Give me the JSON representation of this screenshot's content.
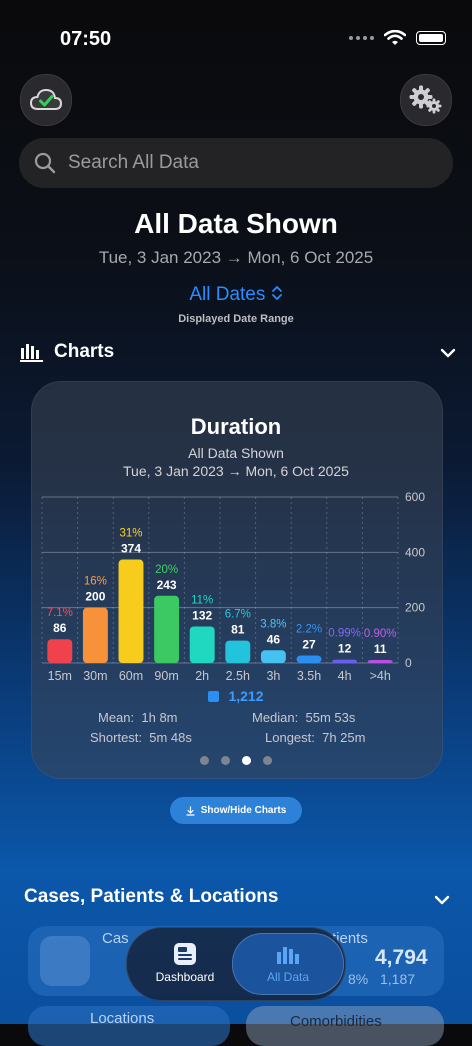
{
  "status": {
    "time": "07:50"
  },
  "search": {
    "placeholder": "Search All Data"
  },
  "header": {
    "title": "All Data Shown",
    "range": "Tue, 3 Jan 2023 → Mon, 6 Oct 2025",
    "dates_link": "All Dates",
    "caption": "Displayed Date Range"
  },
  "charts_section": {
    "label": "Charts"
  },
  "chart_card": {
    "title": "Duration",
    "subtitle": "All Data Shown",
    "range": "Tue, 3 Jan 2023 → Mon, 6 Oct 2025",
    "total": "1,212",
    "stats": {
      "mean_label": "Mean:",
      "mean_value": "1h 8m",
      "median_label": "Median:",
      "median_value": "55m 53s",
      "shortest_label": "Shortest:",
      "shortest_value": "5m 48s",
      "longest_label": "Longest:",
      "longest_value": "7h 25m"
    },
    "pages": 4,
    "active_page": 2
  },
  "chart_data": {
    "type": "bar",
    "categories": [
      "15m",
      "30m",
      "60m",
      "90m",
      "2h",
      "2.5h",
      "3h",
      "3.5h",
      "4h",
      ">4h"
    ],
    "values": [
      86,
      200,
      374,
      243,
      132,
      81,
      46,
      27,
      12,
      11
    ],
    "percent_labels": [
      "7.1%",
      "16%",
      "31%",
      "20%",
      "11%",
      "6.7%",
      "3.8%",
      "2.2%",
      "0.99%",
      "0.90%"
    ],
    "colors": [
      "#f0424d",
      "#f7923a",
      "#f7cc1c",
      "#3cc862",
      "#20d8c0",
      "#22c4dd",
      "#45c2f2",
      "#2a8ff0",
      "#6a5cf0",
      "#c04ce6"
    ],
    "percent_colors": [
      "#ff4d55",
      "#ff9c3d",
      "#ffd21e",
      "#3ed064",
      "#24d6c0",
      "#28c8e0",
      "#4ac8f5",
      "#3596f5",
      "#8068ff",
      "#c659ee"
    ],
    "yticks": [
      0,
      200,
      400,
      600
    ],
    "ylim": [
      0,
      600
    ],
    "grid": true
  },
  "show_hide_button": {
    "label": "Show/Hide Charts"
  },
  "cases_section": {
    "label": "Cases, Patients & Locations"
  },
  "tiles": {
    "cases_label": "Cas",
    "patients_label": "tients",
    "patients_value": "4,794",
    "patients_sub": "1,187",
    "patients_pct": "8%",
    "locations_label": "Locations",
    "comorbidities_label": "Comorbidities"
  },
  "tabbar": {
    "dashboard": "Dashboard",
    "all_data": "All Data"
  }
}
